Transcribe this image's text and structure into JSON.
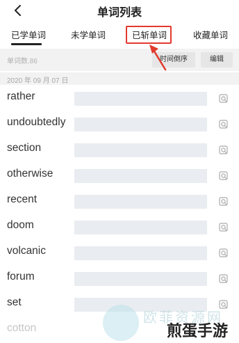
{
  "header": {
    "title": "单词列表"
  },
  "tabs": [
    {
      "label": "已学单词",
      "active": true
    },
    {
      "label": "未学单词",
      "active": false
    },
    {
      "label": "已斩单词",
      "active": false,
      "highlighted": true
    },
    {
      "label": "收藏单词",
      "active": false
    }
  ],
  "toolbar": {
    "count": "单词数.86",
    "sort_label": "时间倒序",
    "edit_label": "编辑"
  },
  "date_label": "2020 年 09 月 07 日",
  "words": [
    "rather",
    "undoubtedly",
    "section",
    "otherwise",
    "recent",
    "doom",
    "volcanic",
    "forum",
    "set",
    "cotton"
  ],
  "watermark": {
    "site_text": "欧菲资源网",
    "brand_text": "煎蛋手游"
  },
  "colors": {
    "highlight": "#e23a2e",
    "meaning_bar": "#e9ecf0",
    "toolbar_bg": "#f2f2f2"
  },
  "icons": {
    "back": "chevron-left-icon",
    "word_action": "search-sound-icon"
  }
}
